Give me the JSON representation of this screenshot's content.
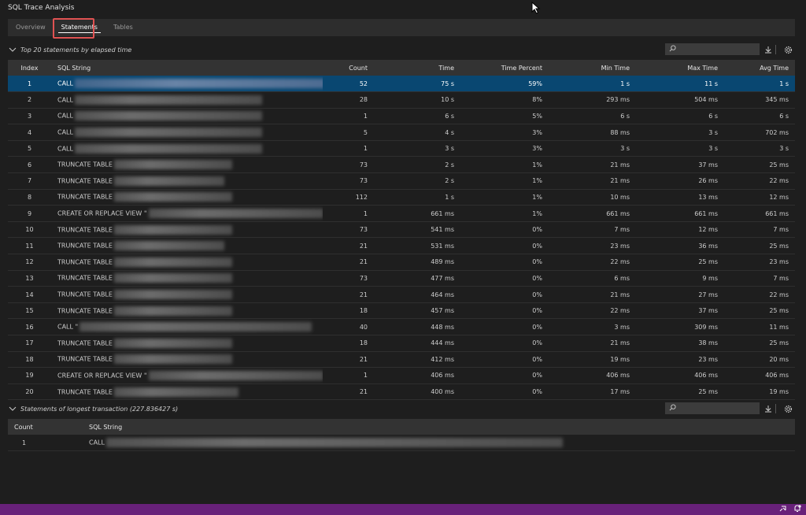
{
  "app": {
    "title": "SQL Trace Analysis"
  },
  "tabs": [
    {
      "label": "Overview"
    },
    {
      "label": "Statements"
    },
    {
      "label": "Tables"
    }
  ],
  "top_statements": {
    "title": "Top 20 statements by elapsed time",
    "search_placeholder": "",
    "columns": [
      "Index",
      "SQL String",
      "Count",
      "Time",
      "Time Percent",
      "Min Time",
      "Max Time",
      "Avg Time"
    ],
    "rows": [
      {
        "index": "1",
        "sql": "CALL",
        "count": "52",
        "time": "75 s",
        "pct": "59%",
        "min": "1 s",
        "max": "11 s",
        "avg": "1 s"
      },
      {
        "index": "2",
        "sql": "CALL",
        "count": "28",
        "time": "10 s",
        "pct": "8%",
        "min": "293 ms",
        "max": "504 ms",
        "avg": "345 ms"
      },
      {
        "index": "3",
        "sql": "CALL",
        "count": "1",
        "time": "6 s",
        "pct": "5%",
        "min": "6 s",
        "max": "6 s",
        "avg": "6 s"
      },
      {
        "index": "4",
        "sql": "CALL",
        "count": "5",
        "time": "4 s",
        "pct": "3%",
        "min": "88 ms",
        "max": "3 s",
        "avg": "702 ms"
      },
      {
        "index": "5",
        "sql": "CALL",
        "count": "1",
        "time": "3 s",
        "pct": "3%",
        "min": "3 s",
        "max": "3 s",
        "avg": "3 s"
      },
      {
        "index": "6",
        "sql": "TRUNCATE TABLE",
        "count": "73",
        "time": "2 s",
        "pct": "1%",
        "min": "21 ms",
        "max": "37 ms",
        "avg": "25 ms"
      },
      {
        "index": "7",
        "sql": "TRUNCATE TABLE",
        "count": "73",
        "time": "2 s",
        "pct": "1%",
        "min": "21 ms",
        "max": "26 ms",
        "avg": "22 ms"
      },
      {
        "index": "8",
        "sql": "TRUNCATE TABLE",
        "count": "112",
        "time": "1 s",
        "pct": "1%",
        "min": "10 ms",
        "max": "13 ms",
        "avg": "12 ms"
      },
      {
        "index": "9",
        "sql": "CREATE OR REPLACE VIEW \"",
        "count": "1",
        "time": "661 ms",
        "pct": "1%",
        "min": "661 ms",
        "max": "661 ms",
        "avg": "661 ms"
      },
      {
        "index": "10",
        "sql": "TRUNCATE TABLE",
        "count": "73",
        "time": "541 ms",
        "pct": "0%",
        "min": "7 ms",
        "max": "12 ms",
        "avg": "7 ms"
      },
      {
        "index": "11",
        "sql": "TRUNCATE TABLE",
        "count": "21",
        "time": "531 ms",
        "pct": "0%",
        "min": "23 ms",
        "max": "36 ms",
        "avg": "25 ms"
      },
      {
        "index": "12",
        "sql": "TRUNCATE TABLE",
        "count": "21",
        "time": "489 ms",
        "pct": "0%",
        "min": "22 ms",
        "max": "25 ms",
        "avg": "23 ms"
      },
      {
        "index": "13",
        "sql": "TRUNCATE TABLE",
        "count": "73",
        "time": "477 ms",
        "pct": "0%",
        "min": "6 ms",
        "max": "9 ms",
        "avg": "7 ms"
      },
      {
        "index": "14",
        "sql": "TRUNCATE TABLE",
        "count": "21",
        "time": "464 ms",
        "pct": "0%",
        "min": "21 ms",
        "max": "27 ms",
        "avg": "22 ms"
      },
      {
        "index": "15",
        "sql": "TRUNCATE TABLE",
        "count": "18",
        "time": "457 ms",
        "pct": "0%",
        "min": "22 ms",
        "max": "37 ms",
        "avg": "25 ms"
      },
      {
        "index": "16",
        "sql": "CALL \"",
        "count": "40",
        "time": "448 ms",
        "pct": "0%",
        "min": "3 ms",
        "max": "309 ms",
        "avg": "11 ms"
      },
      {
        "index": "17",
        "sql": "TRUNCATE TABLE",
        "count": "18",
        "time": "444 ms",
        "pct": "0%",
        "min": "21 ms",
        "max": "38 ms",
        "avg": "25 ms"
      },
      {
        "index": "18",
        "sql": "TRUNCATE TABLE",
        "count": "21",
        "time": "412 ms",
        "pct": "0%",
        "min": "19 ms",
        "max": "23 ms",
        "avg": "20 ms"
      },
      {
        "index": "19",
        "sql": "CREATE OR REPLACE VIEW \"",
        "count": "1",
        "time": "406 ms",
        "pct": "0%",
        "min": "406 ms",
        "max": "406 ms",
        "avg": "406 ms"
      },
      {
        "index": "20",
        "sql": "TRUNCATE TABLE",
        "count": "21",
        "time": "400 ms",
        "pct": "0%",
        "min": "17 ms",
        "max": "25 ms",
        "avg": "19 ms"
      }
    ]
  },
  "longest_transaction": {
    "title": "Statements of longest transaction (227.836427 s)",
    "search_placeholder": "",
    "columns": [
      "Count",
      "SQL String"
    ],
    "rows": [
      {
        "count": "1",
        "sql": "CALL"
      }
    ]
  },
  "icons": {
    "collapse": "chevron-down-icon",
    "search": "search-icon",
    "export": "download-icon",
    "settings": "gear-icon",
    "status_feedback": "feedback-icon",
    "status_bell": "bell-icon"
  },
  "colors": {
    "selected_row": "#094771",
    "statusbar": "#68217a",
    "highlight_box": "#e05252"
  }
}
